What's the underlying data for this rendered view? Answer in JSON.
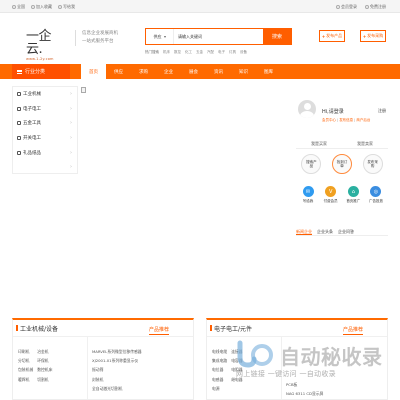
{
  "topbar": {
    "left": [
      "全国",
      "加入收藏",
      "写给我"
    ],
    "right": [
      "会员登录",
      "免费注册"
    ]
  },
  "logo": {
    "mark": "一企云.",
    "url": "www.1-2y.com"
  },
  "slogan": [
    "信息企业发展商机",
    "一站式服务平台"
  ],
  "search": {
    "category": "供应",
    "placeholder": "请输入关键词",
    "button": "搜索"
  },
  "hotwords": {
    "label": "热门搜索",
    "items": [
      "机床",
      "数控",
      "化工",
      "五金",
      "汽配",
      "电子",
      "灯具",
      "设备"
    ]
  },
  "head_buttons": [
    "发布产品",
    "发布采购"
  ],
  "navbar": {
    "category_label": "行业分类",
    "items": [
      "首页",
      "供应",
      "求购",
      "企业",
      "展会",
      "资讯",
      "知识",
      "图库"
    ],
    "active_index": 0
  },
  "side_categories": [
    "工业机械",
    "电子电工",
    "五金工具",
    "开关电工",
    "礼品纸品",
    ""
  ],
  "user": {
    "greeting": "Hi,请登录",
    "register": "注册",
    "links": [
      "会员中心",
      "发布信息",
      "商户后台"
    ],
    "role_tabs": [
      "我是买家",
      "我是卖家"
    ],
    "circles": [
      "搜索产品",
      "找到订单",
      "发布采购"
    ],
    "icons": [
      {
        "label": "写给我",
        "color": "#2f9bf0",
        "glyph": "✉"
      },
      {
        "label": "付费会员",
        "color": "#f0a020",
        "glyph": "V"
      },
      {
        "label": "首页推广",
        "color": "#2ab0a0",
        "glyph": "⌂"
      },
      {
        "label": "广告投放",
        "color": "#3a8de0",
        "glyph": "◎"
      }
    ]
  },
  "news_tabs": [
    "新闻企业",
    "企业头条",
    "企业问答"
  ],
  "floors": [
    {
      "title": "工业机械/设备",
      "recommend": "产品推荐",
      "col1": [
        "印刷机",
        "分切机",
        "包装机械",
        "暖焊机"
      ],
      "col2": [
        "冶金机",
        "环保机",
        "数控机床",
        "切割机"
      ],
      "products": [
        "MARVEL系列微型位移传感器",
        "XJ2001-01系列称重显示仪",
        "振动筛",
        "封装机",
        "全自动激光切割机"
      ]
    },
    {
      "title": "电子电工/元件",
      "recommend": "产品推荐",
      "col1": [
        "电线电缆",
        "集成电路",
        "电位器",
        "电感器",
        "电源"
      ],
      "col2": [
        "连接器",
        "电容器",
        "电阻器",
        "继电器"
      ],
      "products": [
        "PCB板",
        "NAG 6311 CD显示屏"
      ]
    }
  ],
  "watermark": {
    "title": "自动秘收录",
    "sub": "网上链接 一键访问 一自动收录"
  }
}
